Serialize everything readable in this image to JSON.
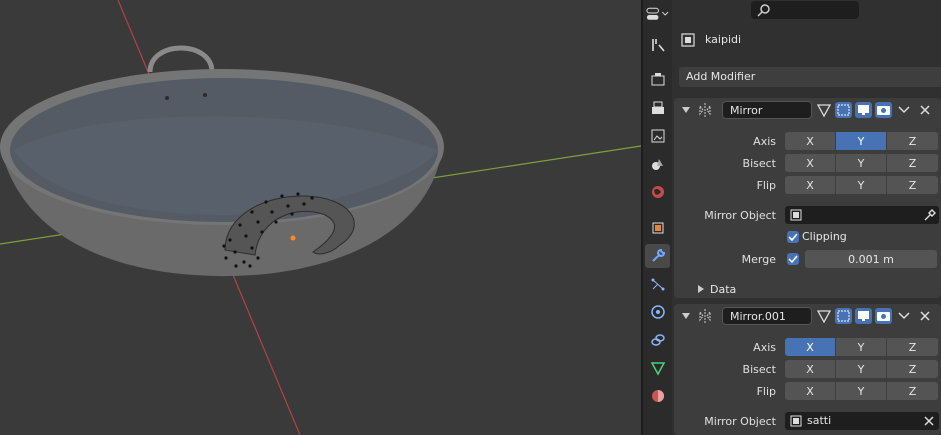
{
  "object": {
    "name": "kaipidi"
  },
  "add_modifier_label": "Add Modifier",
  "modifiers": [
    {
      "name": "Mirror",
      "rows": {
        "axis": {
          "label": "Axis",
          "x": "X",
          "y": "Y",
          "z": "Z",
          "active": "Y"
        },
        "bisect": {
          "label": "Bisect",
          "x": "X",
          "y": "Y",
          "z": "Z"
        },
        "flip": {
          "label": "Flip",
          "x": "X",
          "y": "Y",
          "z": "Z"
        }
      },
      "mirror_object": {
        "label": "Mirror Object",
        "value": ""
      },
      "clipping_label": "Clipping",
      "merge": {
        "label": "Merge",
        "value": "0.001 m"
      },
      "data_label": "Data"
    },
    {
      "name": "Mirror.001",
      "rows": {
        "axis": {
          "label": "Axis",
          "x": "X",
          "y": "Y",
          "z": "Z",
          "active": "X"
        },
        "bisect": {
          "label": "Bisect",
          "x": "X",
          "y": "Y",
          "z": "Z"
        },
        "flip": {
          "label": "Flip",
          "x": "X",
          "y": "Y",
          "z": "Z"
        }
      },
      "mirror_object": {
        "label": "Mirror Object",
        "value": "satti"
      }
    }
  ],
  "colors": {
    "accent": "#4772b3",
    "active_tab": "#494949",
    "x_axis": "#b0424a",
    "y_axis": "#7ea23a"
  }
}
